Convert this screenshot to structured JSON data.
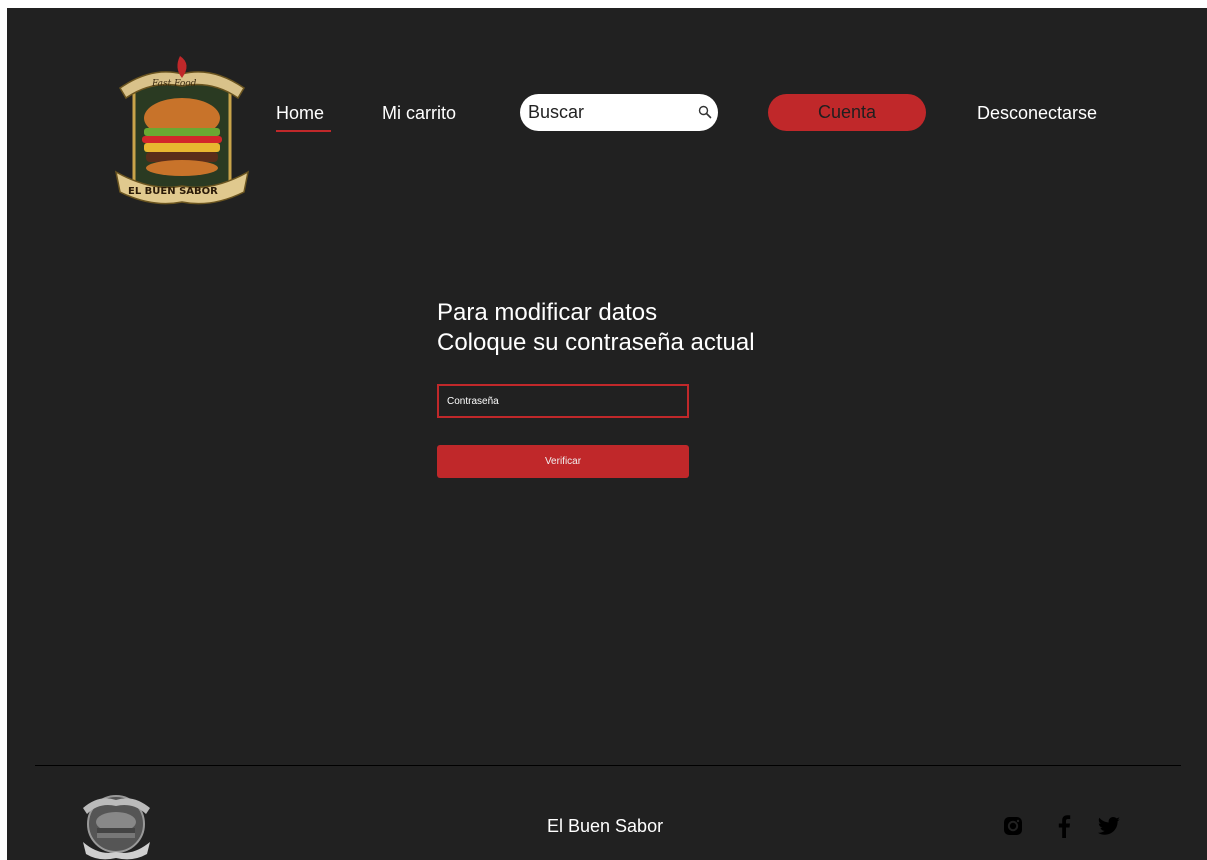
{
  "header": {
    "logo_text_top": "Fast Food",
    "logo_text_banner": "EL BUEN SABOR",
    "nav": {
      "home": "Home",
      "cart": "Mi carrito",
      "logout": "Desconectarse"
    },
    "search": {
      "placeholder": "Buscar",
      "icon": "search-icon"
    },
    "account_label": "Cuenta"
  },
  "main": {
    "title_line1": "Para modificar datos",
    "title_line2": "Coloque su contraseña actual",
    "password_placeholder": "Contraseña",
    "verify_label": "Verificar"
  },
  "footer": {
    "title": "El Buen Sabor",
    "social_icons": [
      "instagram-icon",
      "facebook-icon",
      "twitter-icon"
    ]
  },
  "colors": {
    "background": "#212121",
    "accent": "#c0282a",
    "text": "#ffffff"
  }
}
